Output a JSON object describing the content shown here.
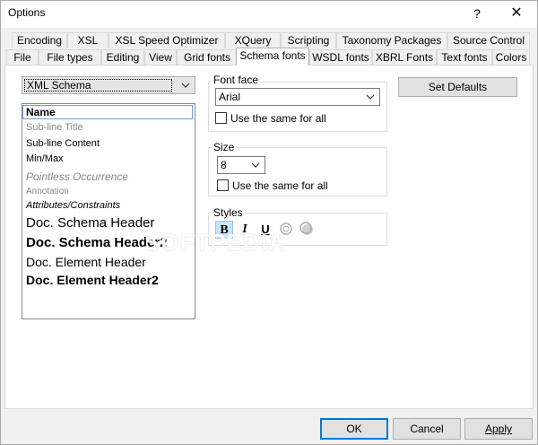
{
  "window": {
    "title": "Options",
    "help_glyph": "?",
    "close_glyph": "✕"
  },
  "tabs_row1": [
    {
      "label": "Encoding"
    },
    {
      "label": "XSL"
    },
    {
      "label": "XSL Speed Optimizer"
    },
    {
      "label": "XQuery"
    },
    {
      "label": "Scripting"
    },
    {
      "label": "Taxonomy Packages"
    },
    {
      "label": "Source Control"
    }
  ],
  "tabs_row2": [
    {
      "label": "File"
    },
    {
      "label": "File types"
    },
    {
      "label": "Editing"
    },
    {
      "label": "View"
    },
    {
      "label": "Grid fonts"
    },
    {
      "label": "Schema fonts",
      "active": true
    },
    {
      "label": "WSDL fonts"
    },
    {
      "label": "XBRL Fonts"
    },
    {
      "label": "Text fonts"
    },
    {
      "label": "Colors"
    }
  ],
  "schema_select": {
    "value": "XML Schema"
  },
  "font_items": [
    {
      "label": "Name"
    },
    {
      "label": "Sub-line Title"
    },
    {
      "label": "Sub-line Content"
    },
    {
      "label": "Min/Max"
    },
    {
      "label": "Pointless Occurrence"
    },
    {
      "label": "Annotation"
    },
    {
      "label": "Attributes/Constraints"
    },
    {
      "label": "Doc. Schema Header"
    },
    {
      "label": "Doc. Schema Header2"
    },
    {
      "label": "Doc. Element Header"
    },
    {
      "label": "Doc. Element Header2"
    }
  ],
  "font_face": {
    "group_label": "Font face",
    "value": "Arial",
    "same_for_all_label": "Use the same for all"
  },
  "size": {
    "group_label": "Size",
    "value": "8",
    "same_for_all_label": "Use the same for all"
  },
  "styles": {
    "group_label": "Styles",
    "bold": "B",
    "italic": "I",
    "underline": "U"
  },
  "set_defaults_label": "Set Defaults",
  "footer": {
    "ok_label": "OK",
    "cancel_label": "Cancel",
    "apply_label": "Apply"
  },
  "watermark_text": "SOFTPEDIA"
}
